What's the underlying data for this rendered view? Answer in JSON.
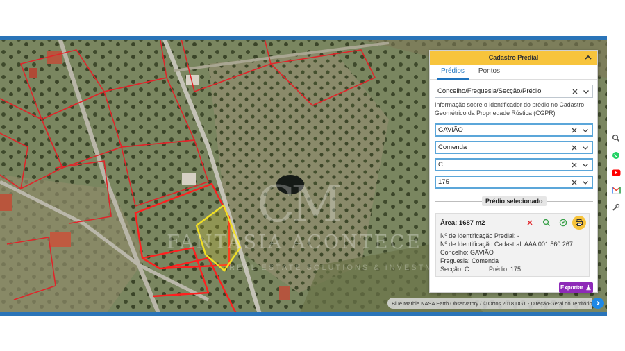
{
  "panel": {
    "title": "Cadastro Predial",
    "tabs": [
      {
        "label": "Prédios",
        "active": true
      },
      {
        "label": "Pontos",
        "active": false
      }
    ],
    "mode_select": "Concelho/Freguesia/Secção/Prédio",
    "info_text": "Informação sobre o identificador do prédio no Cadastro Geométrico da Propriedade Rústica (CGPR)",
    "filters": {
      "concelho": "GAVIÃO",
      "freguesia": "Comenda",
      "seccao": "C",
      "predio": "175"
    },
    "selected_label": "Prédio selecionado",
    "selected": {
      "area": "Área: 1687 m2",
      "id_predial": "Nº de Identificação Predial: -",
      "id_cadastral": "Nº de Identificação Cadastral: AAA 001 560 267",
      "concelho": "Concelho: GAVIÃO",
      "freguesia": "Freguesia: Comenda",
      "seccao": "Secção: C",
      "predio": "Prédio: 175"
    },
    "export_label": "Exportar"
  },
  "map": {
    "attribution": "Blue Marble NASA Earth Observatory / © Ortos 2018 DGT - Direção-Geral do Território",
    "watermark": {
      "monogram": "CM",
      "name": "FANTASIA ACONTECE",
      "tagline": "REAL ESTATE SOLUTIONS & INVESTMENTS"
    }
  },
  "side_icons": [
    "search-icon",
    "whatsapp-icon",
    "youtube-icon",
    "gmail-icon",
    "wrench-icon"
  ],
  "colors": {
    "accent": "#f7c43c",
    "tab_active": "#1e73be",
    "export": "#8e2ab8",
    "parcel_border": "#e0252a",
    "selected_parcel": "#f2e024"
  }
}
